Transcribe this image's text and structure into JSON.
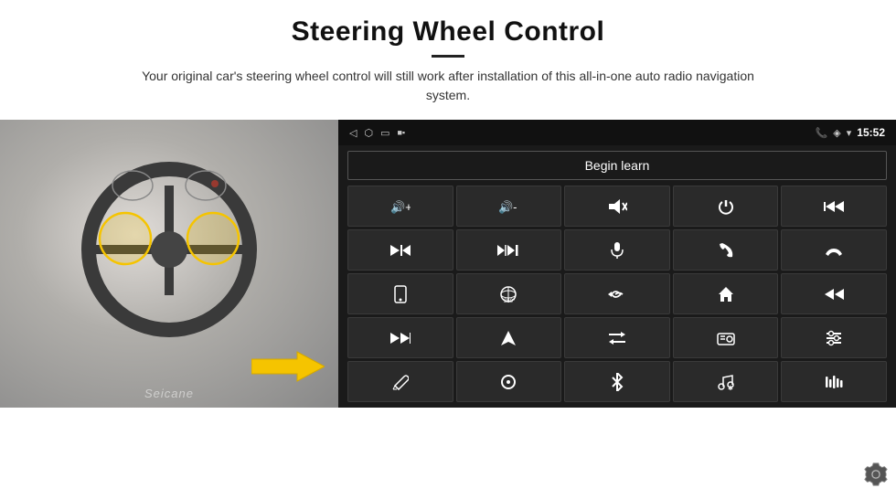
{
  "header": {
    "title": "Steering Wheel Control",
    "description": "Your original car's steering wheel control will still work after installation of this all-in-one auto radio navigation system."
  },
  "status_bar": {
    "left_icons": [
      "◁",
      "⬜",
      "◻"
    ],
    "right_time": "15:52",
    "right_icons": [
      "📞",
      "◈",
      "▾"
    ]
  },
  "begin_learn_button": "Begin learn",
  "control_buttons": [
    {
      "icon": "🔊+",
      "label": "vol-up"
    },
    {
      "icon": "🔊−",
      "label": "vol-down"
    },
    {
      "icon": "🔇",
      "label": "mute"
    },
    {
      "icon": "⏻",
      "label": "power"
    },
    {
      "icon": "⏮",
      "label": "prev-track-hold"
    },
    {
      "icon": "⏭",
      "label": "next"
    },
    {
      "icon": "⏭⏭",
      "label": "skip-forward"
    },
    {
      "icon": "🎤",
      "label": "mic"
    },
    {
      "icon": "📞",
      "label": "phone"
    },
    {
      "icon": "↩",
      "label": "hang-up"
    },
    {
      "icon": "📱",
      "label": "phone2"
    },
    {
      "icon": "🔄",
      "label": "360-view"
    },
    {
      "icon": "↩",
      "label": "back"
    },
    {
      "icon": "🏠",
      "label": "home"
    },
    {
      "icon": "⏮",
      "label": "rewind"
    },
    {
      "icon": "⏭",
      "label": "fast-forward"
    },
    {
      "icon": "➤",
      "label": "navigate"
    },
    {
      "icon": "⇄",
      "label": "swap"
    },
    {
      "icon": "📻",
      "label": "radio"
    },
    {
      "icon": "⇌",
      "label": "adjust"
    },
    {
      "icon": "✏",
      "label": "edit"
    },
    {
      "icon": "⊙",
      "label": "circle"
    },
    {
      "icon": "✱",
      "label": "bluetooth"
    },
    {
      "icon": "🎵",
      "label": "music"
    },
    {
      "icon": "📊",
      "label": "equalizer"
    }
  ],
  "watermark": "Seicane",
  "settings_label": "Settings"
}
